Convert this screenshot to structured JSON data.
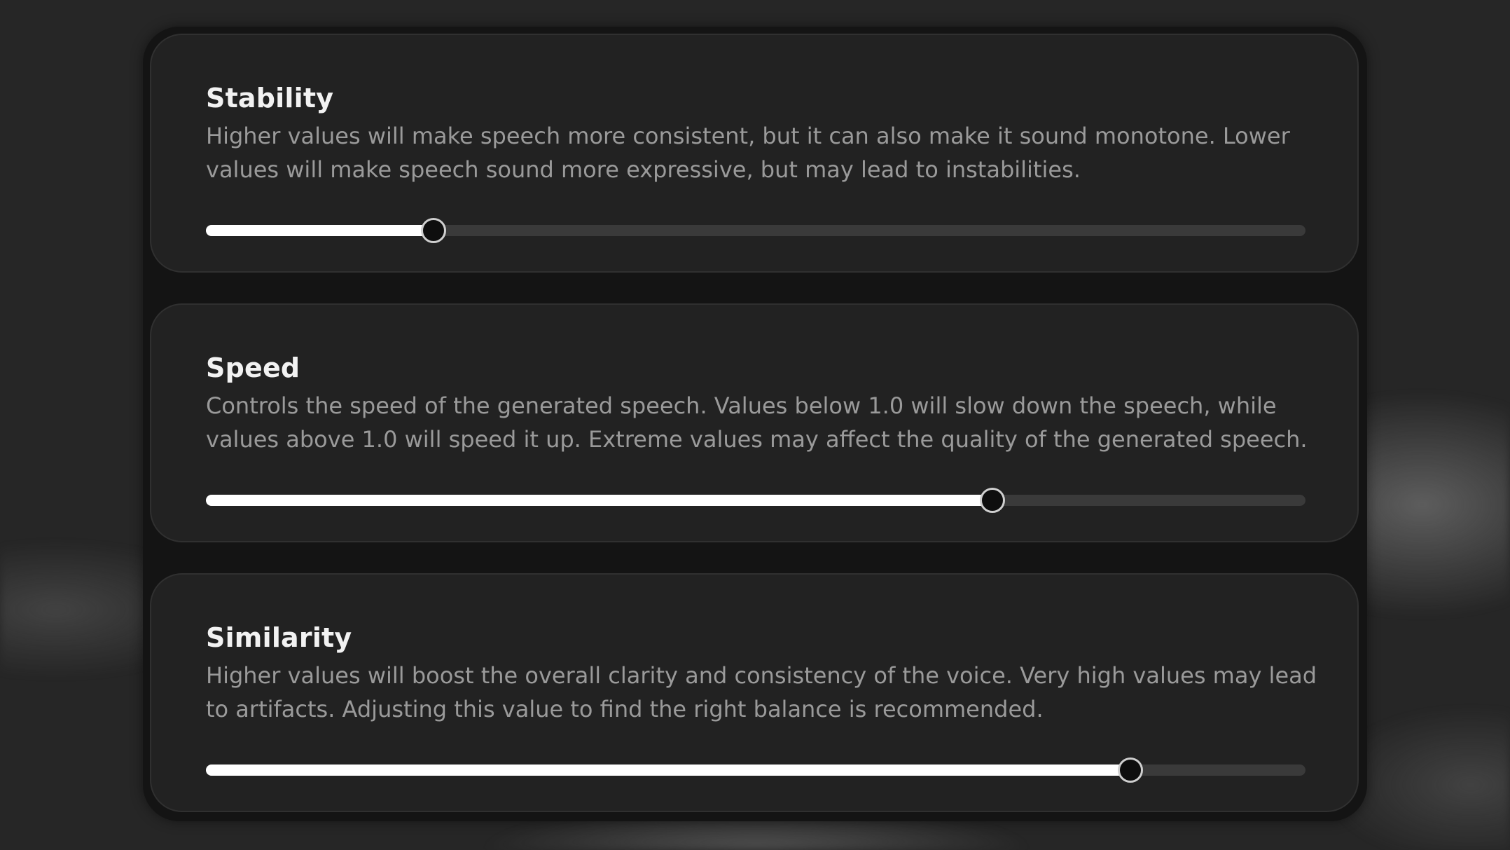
{
  "settings": [
    {
      "title": "Stability",
      "description": "Higher values will make speech more consistent, but it can also make it sound monotone. Lower values will make speech sound more expressive, but may lead to instabilities.",
      "value_fraction": 0.207
    },
    {
      "title": "Speed",
      "description": "Controls the speed of the generated speech. Values below 1.0 will slow down the speech, while values above 1.0 will speed it up. Extreme values may affect the quality of the generated speech.",
      "value_fraction": 0.715
    },
    {
      "title": "Similarity",
      "description": "Higher values will boost the overall clarity and consistency of the voice. Very high values may lead to artifacts. Adjusting this value to find the right balance is recommended.",
      "value_fraction": 0.841
    }
  ]
}
